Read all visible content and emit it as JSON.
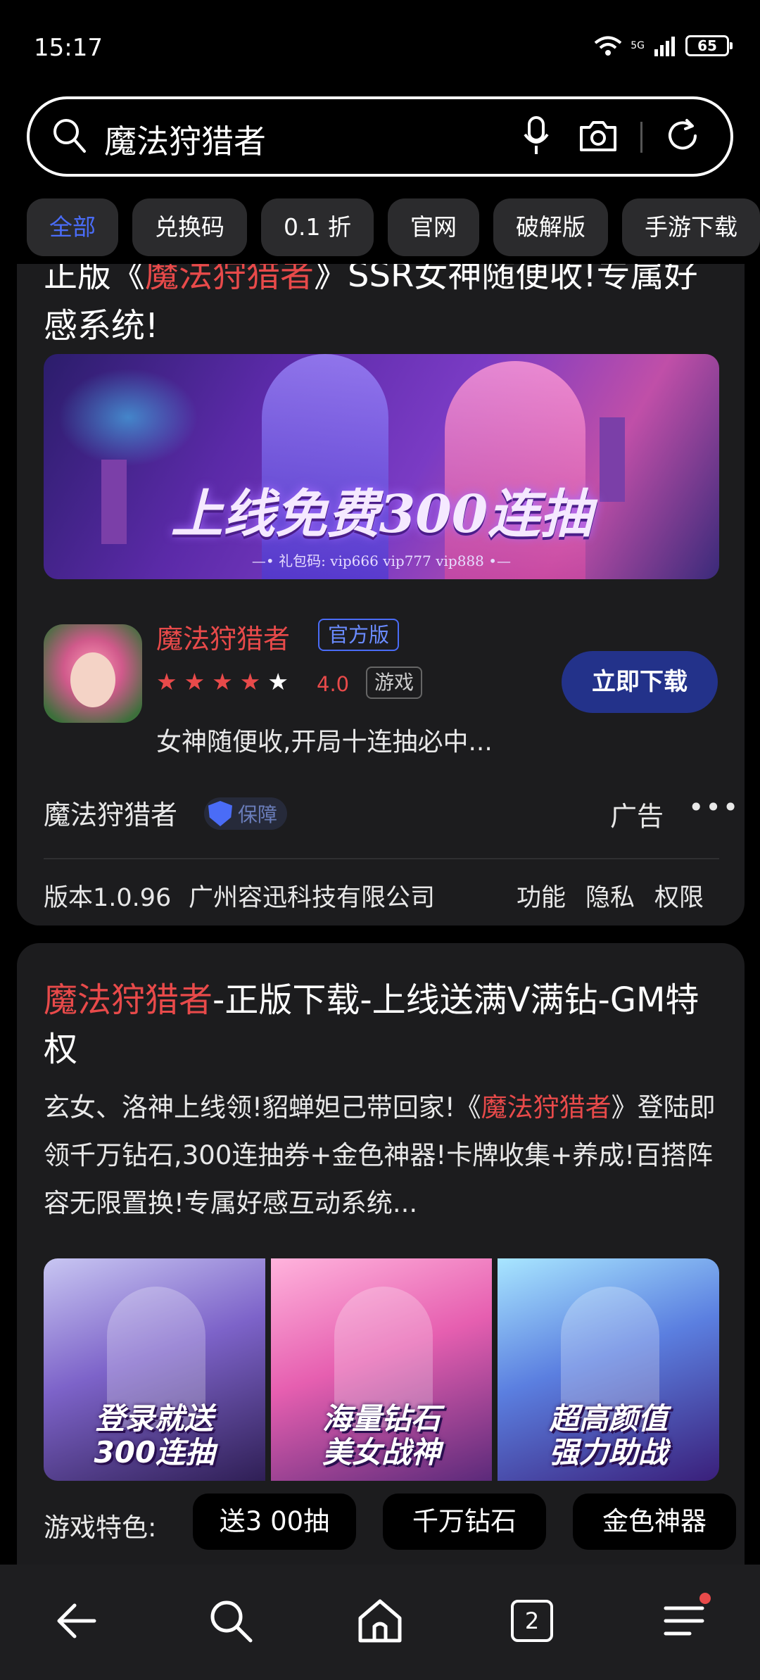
{
  "status_bar": {
    "time": "15:17",
    "network": "5G",
    "battery": "65"
  },
  "search": {
    "query": "魔法狩猎者"
  },
  "filters": [
    "全部",
    "兑换码",
    "0.1 折",
    "官网",
    "破解版",
    "手游下载"
  ],
  "ad_card": {
    "title_prefix": "正版《",
    "title_highlight": "魔法狩猎者",
    "title_suffix": "》SSR女神随便收!专属好感系统!",
    "banner_headline": "上线免费300连抽",
    "banner_subtitle": "—• 礼包码: vip666 vip777 vip888 •—",
    "app_name": "魔法狩猎者",
    "official_badge": "官方版",
    "rating_value": 4.0,
    "rating_text": "4.0",
    "type_badge": "游戏",
    "app_desc": "女神随便收,开局十连抽必中...",
    "download_label": "立即下载",
    "source_name": "魔法狩猎者",
    "guarantee_label": "保障",
    "ad_label": "广告",
    "version": "版本1.0.96",
    "company": "广州容迅科技有限公司",
    "links": [
      "功能",
      "隐私",
      "权限"
    ]
  },
  "result_card": {
    "title_highlight": "魔法狩猎者",
    "title_rest": "-正版下载-上线送满V满钻-GM特权",
    "desc_1": "玄女、洛神上线领!貂蝉妲己带回家!《",
    "desc_highlight": "魔法狩猎者",
    "desc_2": "》登陆即领千万钻石,300连抽券+金色神器!卡牌收集+养成!百搭阵容无限置换!专属好感互动系统...",
    "thumbs": [
      {
        "text1": "登录就送",
        "text2": "300连抽"
      },
      {
        "text1": "海量钻石",
        "text2": "美女战神"
      },
      {
        "text1": "超高颜值",
        "text2": "强力助战"
      }
    ],
    "feature_label": "游戏特色:",
    "features": [
      "送3 00抽",
      "千万钻石",
      "金色神器"
    ]
  },
  "bottom_nav": {
    "tab_count": "2"
  },
  "colors": {
    "highlight": "#e84a4a",
    "accent": "#4a6cf7",
    "download_button": "#23328a",
    "card_bg": "#1c1c1e"
  }
}
